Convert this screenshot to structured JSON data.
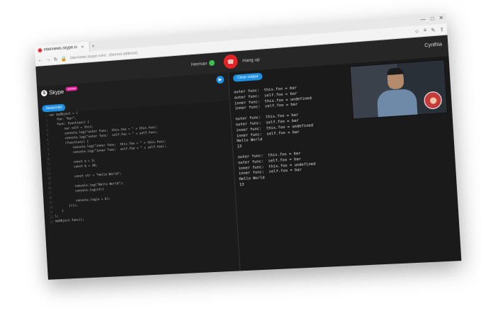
{
  "browser": {
    "tab_title": "interviews.skype.co",
    "tab_close": "×",
    "new_tab": "+",
    "url": "interviews.skype.com/...(blurred address)",
    "window_controls": [
      "—",
      "□",
      "✕"
    ],
    "nav": {
      "back": "←",
      "forward": "→",
      "refresh": "↻",
      "lock": "🔒"
    },
    "tools": [
      "☆",
      "≡",
      "✎",
      "⇪"
    ]
  },
  "call": {
    "caller_name": "Herman",
    "caller_status_color": "#3cc04d",
    "hangup_label": "Hang up",
    "hangup_color": "#e32325",
    "user_name": "Cynthia"
  },
  "app": {
    "brand": "Skype",
    "beta_badge": "preview",
    "language_button": "Javascript",
    "run_icon": "▶",
    "accent_color": "#1e8fe0"
  },
  "editor": {
    "lines": [
      {
        "n": "1",
        "text": "var myObject = {"
      },
      {
        "n": "2",
        "text": "    foo: \"bar\","
      },
      {
        "n": "3",
        "text": "    func: function() {"
      },
      {
        "n": "4",
        "text": "        var self = this;"
      },
      {
        "n": "5",
        "text": "        console.log(\"outer func:  this.foo = \" + this.foo);"
      },
      {
        "n": "6",
        "text": "        console.log(\"outer func:  self.foo = \" + self.foo);"
      },
      {
        "n": "7",
        "text": "        (function() {"
      },
      {
        "n": "8",
        "text": "            console.log(\"inner func:  this.foo = \" + this.foo);"
      },
      {
        "n": "9",
        "text": "            console.log(\"inner func:  self.foo = \" + self.foo);"
      },
      {
        "n": "10",
        "text": ""
      },
      {
        "n": "11",
        "text": "            const a = 3;"
      },
      {
        "n": "12",
        "text": "            const b = 10;"
      },
      {
        "n": "13",
        "text": ""
      },
      {
        "n": "14",
        "text": "            const str = \"Hello World\";"
      },
      {
        "n": "15",
        "text": ""
      },
      {
        "n": "16",
        "text": "            console.log(\"Hello World\");"
      },
      {
        "n": "17",
        "text": "            console.log(str)"
      },
      {
        "n": "18",
        "text": ""
      },
      {
        "n": "19",
        "text": "            console.log(a + b);"
      },
      {
        "n": "20",
        "text": "        }());"
      },
      {
        "n": "21",
        "text": "    }"
      },
      {
        "n": "22",
        "text": "};"
      },
      {
        "n": "23",
        "text": "myObject.func();"
      }
    ]
  },
  "output": {
    "clear_button": "Clear output",
    "blocks": [
      [
        "outer func:  this.foo = bar",
        "outer func:  self.foo = bar",
        "inner func:  this.foo = undefined",
        "inner func:  self.foo = bar"
      ],
      [
        "outer func:  this.foo = bar",
        "outer func:  self.foo = bar",
        "inner func:  this.foo = undefined",
        "inner func:  self.foo = bar",
        "Hello World",
        "13"
      ],
      [
        "outer func:  this.foo = bar",
        "outer func:  self.foo = bar",
        "inner func:  this.foo = undefined",
        "inner func:  self.foo = bar",
        "Hello World",
        "13"
      ]
    ]
  }
}
